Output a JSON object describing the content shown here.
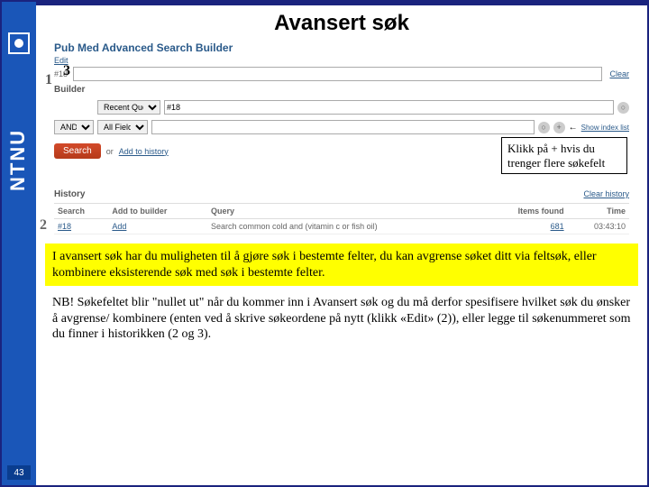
{
  "sidebar": {
    "brand": "NTNU"
  },
  "title": "Avansert søk",
  "pubmed": {
    "heading": "Pub Med Advanced Search Builder",
    "edit": "Edit",
    "n18_label": "#18",
    "clear": "Clear",
    "builder": "Builder",
    "recent_query": "Recent Query",
    "value18": "#18",
    "and": "AND",
    "all_fields": "All Fields",
    "show_index": "Show index list",
    "search_btn": "Search",
    "or": "or",
    "add_history": "Add to history",
    "history": "History",
    "clear_history": "Clear history",
    "cols": {
      "search": "Search",
      "add": "Add to builder",
      "query": "Query",
      "items": "Items found",
      "time": "Time"
    },
    "row": {
      "id": "#18",
      "add": "Add",
      "query": "Search common cold and (vitamin c or fish oil)",
      "items": "681",
      "time": "03:43:10"
    }
  },
  "overlay": {
    "n1": "1",
    "n2": "2",
    "n3": "3"
  },
  "callout": "Klikk på + hvis du trenger flere søkefelt",
  "yellow": "I avansert søk har du muligheten til å gjøre søk i bestemte felter, du kan avgrense søket ditt via feltsøk, eller kombinere eksisterende søk med søk i bestemte felter.",
  "nb": "NB! Søkefeltet blir \"nullet ut\" når du kommer inn i Avansert søk og du må derfor spesifisere hvilket søk du ønsker å avgrense/ kombinere (enten ved å skrive søkeordene på nytt (klikk «Edit» (2)), eller legge til søkenummeret som du finner i historikken (2 og 3).",
  "page": "43"
}
